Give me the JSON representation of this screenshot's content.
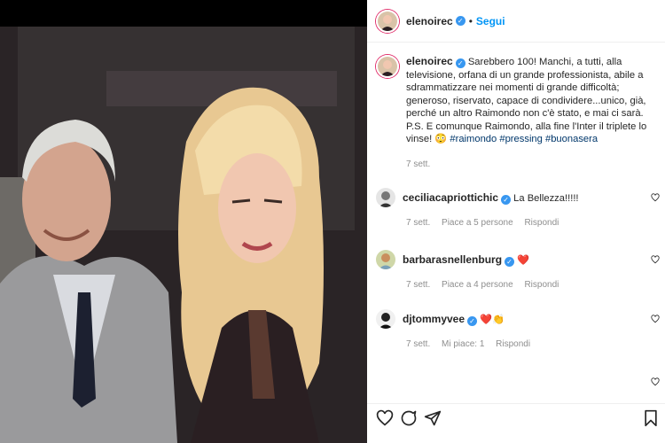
{
  "post": {
    "username": "elenoirec",
    "follow_label": "Segui",
    "separator": "•",
    "caption_pre": "Sarebbero 100! Manchi, a tutti, alla televisione, orfana di un grande professionista, abile a sdrammatizzare nei momenti di grande difficoltà; generoso, riservato, capace di condividere...unico, già, perché un altro Raimondo non c'è stato, e mai ci sarà. P.S. E comunque Raimondo, alla fine l'Inter il triplete lo vinse! 😳 ",
    "hashtags": [
      "#raimondo",
      "#pressing",
      "#buonasera"
    ],
    "time": "7 sett."
  },
  "comments": [
    {
      "username": "ceciliacapriottichic",
      "text": "La Bellezza!!!!!",
      "time": "7 sett.",
      "likes": "Piace a 5 persone",
      "reply": "Rispondi"
    },
    {
      "username": "barbarasnellenburg",
      "text": "❤️",
      "time": "7 sett.",
      "likes": "Piace a 4 persone",
      "reply": "Rispondi"
    },
    {
      "username": "djtommyvee",
      "text": "❤️👏",
      "time": "7 sett.",
      "likes": "Mi piace: 1",
      "reply": "Rispondi"
    }
  ],
  "icons": {
    "like": "heart-icon",
    "comment": "comment-icon",
    "share": "share-icon",
    "save": "bookmark-icon"
  },
  "colors": {
    "link": "#0095f6",
    "hashtag": "#00376b",
    "verified": "#3897f0",
    "muted": "#8e8e8e"
  }
}
